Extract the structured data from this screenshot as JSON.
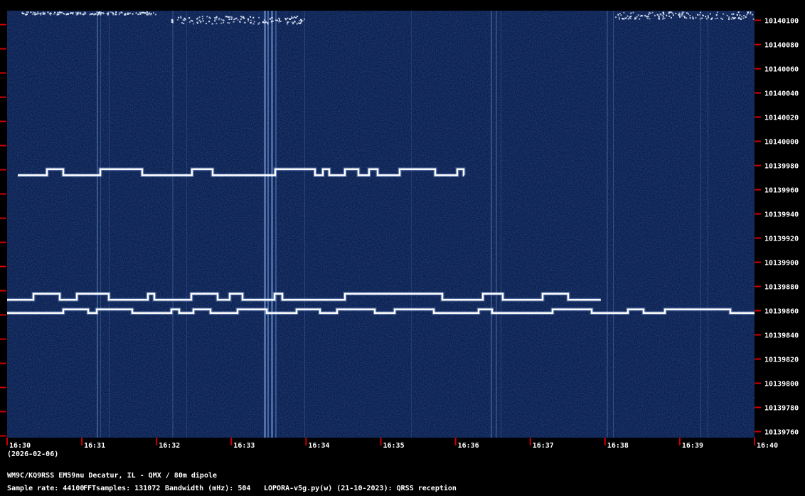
{
  "chart_data": {
    "type": "heatmap",
    "title": "",
    "x_ticks": [
      "16:30",
      "16:31",
      "16:32",
      "16:33",
      "16:34",
      "16:35",
      "16:36",
      "16:37",
      "16:38",
      "16:39",
      "16:40"
    ],
    "date_label": "(2026-02-06)",
    "y_ticks": [
      10140100,
      10140080,
      10140060,
      10140040,
      10140020,
      10140000,
      10139980,
      10139960,
      10139940,
      10139920,
      10139900,
      10139880,
      10139860,
      10139840,
      10139820,
      10139800,
      10139780,
      10139760
    ],
    "y_unit": "Hz",
    "xlim": [
      "16:30",
      "16:40"
    ],
    "ylim": [
      10139755,
      10140108
    ],
    "signals": [
      {
        "x_start": "16:30",
        "x_end": "16:36",
        "low_hz": 10139972,
        "high_hz": 10139977
      },
      {
        "x_start": "16:30",
        "x_end": "16:38",
        "low_hz": 10139869,
        "high_hz": 10139874
      },
      {
        "x_start": "16:30",
        "x_end": "16:40",
        "low_hz": 10139858,
        "high_hz": 10139861
      }
    ],
    "colors": {
      "background": "#0a1e4f",
      "signal": "#ffffff",
      "tick": "#cc0000"
    }
  },
  "info": {
    "station_line": "WM9C/KQ9RSS EM59nu Decatur, IL - QMX / 80m dipole",
    "sample_rate": "Sample rate: 44100",
    "fft_samples": "FFTsamples: 131072",
    "bandwidth": "Bandwidth (mHz): 504",
    "software": "LOPORA-v5g.py(w) (21-10-2023): QRSS reception"
  }
}
